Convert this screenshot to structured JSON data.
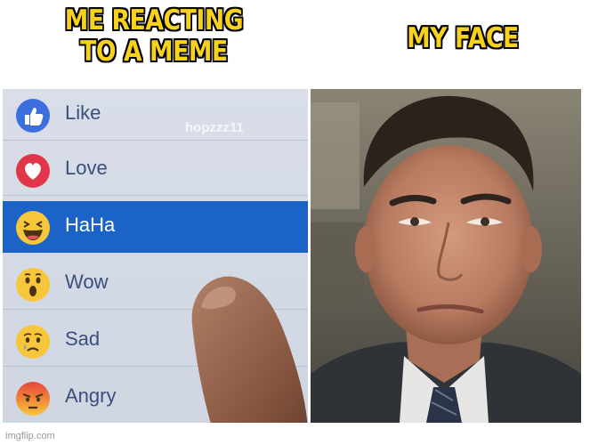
{
  "captions": {
    "left_line1": "ME REACTING",
    "left_line2": "TO A MEME",
    "right": "MY FACE"
  },
  "reactions": [
    {
      "label": "Like",
      "icon": "like-icon",
      "color": "#3b6ede"
    },
    {
      "label": "Love",
      "icon": "love-icon",
      "color": "#e3354a"
    },
    {
      "label": "HaHa",
      "icon": "haha-icon",
      "color": "#f6c63b",
      "selected": true
    },
    {
      "label": "Wow",
      "icon": "wow-icon",
      "color": "#f6c63b"
    },
    {
      "label": "Sad",
      "icon": "sad-icon",
      "color": "#f6c63b"
    },
    {
      "label": "Angry",
      "icon": "angry-icon",
      "color": "#e8603a"
    }
  ],
  "watermark_user": "hopzzz11",
  "selected_color": "#1c63c8",
  "footer": "imgflip.com"
}
